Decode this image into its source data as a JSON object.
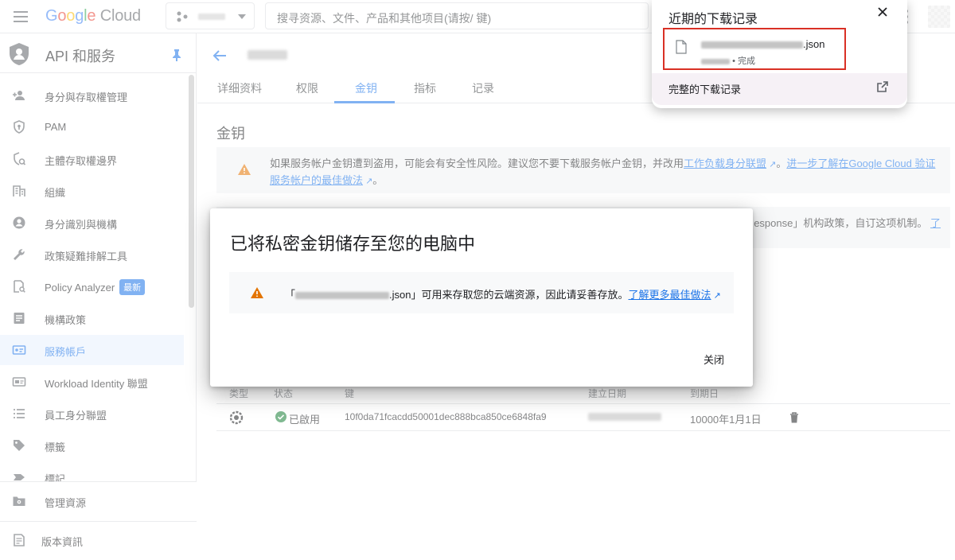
{
  "topbar": {
    "logo_google": [
      "G",
      "o",
      "o",
      "g",
      "l",
      "e"
    ],
    "logo_cloud": "Cloud",
    "search_placeholder": "搜寻资源、文件、产品和其他项目(请按/ 键)"
  },
  "sidebar": {
    "title": "API 和服务",
    "items": [
      {
        "label": "身分與存取權管理",
        "icon": "person-add-icon"
      },
      {
        "label": "PAM",
        "icon": "shield-key-icon"
      },
      {
        "label": "主體存取權邊界",
        "icon": "policy-boundary-icon"
      },
      {
        "label": "組織",
        "icon": "organization-icon"
      },
      {
        "label": "身分識別與機構",
        "icon": "account-circle-icon"
      },
      {
        "label": "政策疑難排解工具",
        "icon": "wrench-icon"
      },
      {
        "label": "Policy Analyzer",
        "icon": "policy-analyzer-icon",
        "badge": "最新"
      },
      {
        "label": "機構政策",
        "icon": "org-policy-icon"
      },
      {
        "label": "服務帳戶",
        "icon": "service-account-icon",
        "active": true
      },
      {
        "label": "Workload Identity 聯盟",
        "icon": "workload-identity-icon"
      },
      {
        "label": "員工身分聯盟",
        "icon": "list-icon"
      },
      {
        "label": "標籤",
        "icon": "tag-icon"
      },
      {
        "label": "標記",
        "icon": "label-icon"
      }
    ],
    "bottom": [
      {
        "label": "管理資源",
        "icon": "folder-gear-icon"
      },
      {
        "label": "版本資訊",
        "icon": "release-notes-icon"
      }
    ]
  },
  "main": {
    "tabs": [
      "详细资料",
      "权限",
      "金钥",
      "指标",
      "记录"
    ],
    "active_tab": 2,
    "section_title": "金钥",
    "warning": {
      "text": "如果服务帐户金钥遭到盗用，可能会有安全性风险。建议您不要下载服务帐户金钥，并改用",
      "link1": "工作负载身分联盟",
      "sep": "。",
      "link2": "进一步了解在Google Cloud 验证服务帐户的最佳做法",
      "end": "。"
    },
    "banner2_text": "esponse」机构政策，自订这项机制。",
    "banner2_link": "了",
    "table": {
      "headers": [
        "类型",
        "状态",
        "键",
        "建立日期",
        "到期日"
      ],
      "row": {
        "status": "已啟用",
        "key": "10f0da71fcacdd50001dec888bca850ce6848fa9",
        "expiry": "10000年1月1日"
      }
    }
  },
  "dialog": {
    "title": "已将私密金钥储存至您的电脑中",
    "warn_prefix": "「",
    "warn_suffix": ".json」可用来存取您的云端资源，因此请妥善存放。",
    "warn_link": "了解更多最佳做法",
    "close_label": "关闭"
  },
  "downloads": {
    "title": "近期的下载记录",
    "file_ext": ".json",
    "status": "• 完成",
    "footer": "完整的下载记录"
  },
  "colors": {
    "accent": "#1a73e8",
    "warning": "#e37400",
    "success": "#188038",
    "highlight_border": "#d93025"
  }
}
